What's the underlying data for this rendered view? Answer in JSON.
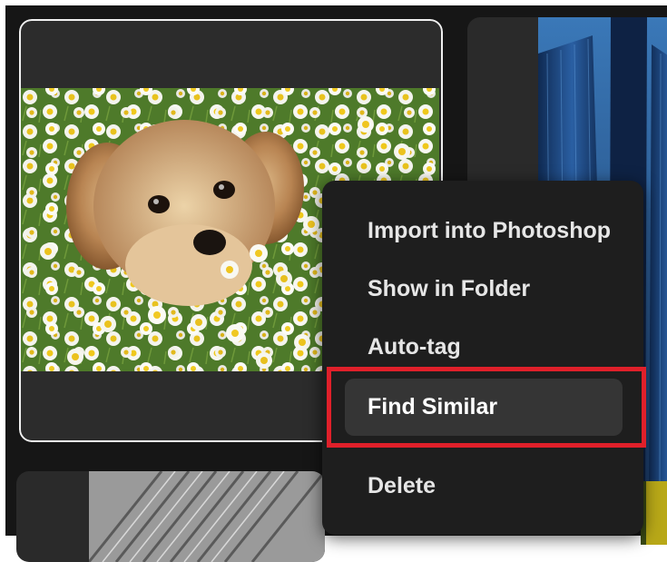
{
  "context_menu": {
    "items": [
      {
        "label": "Import into Photoshop"
      },
      {
        "label": "Show in Folder"
      },
      {
        "label": "Auto-tag"
      },
      {
        "label": "Find Similar",
        "highlighted": true
      },
      {
        "label": "Delete"
      }
    ]
  },
  "colors": {
    "app_background": "#161616",
    "card_background": "#2c2c2c",
    "menu_background": "#1e1e1e",
    "menu_highlight": "#353535",
    "selection_outline": "#f0f0f0",
    "annotation_red": "#e0202a"
  },
  "cards": [
    {
      "subject": "dog-in-daisies-photo",
      "selected": true
    },
    {
      "subject": "city-skyscrapers-photo",
      "selected": false
    },
    {
      "subject": "architecture-lines-photo",
      "selected": false
    },
    {
      "subject": "yellow-green-photo",
      "selected": false
    }
  ]
}
